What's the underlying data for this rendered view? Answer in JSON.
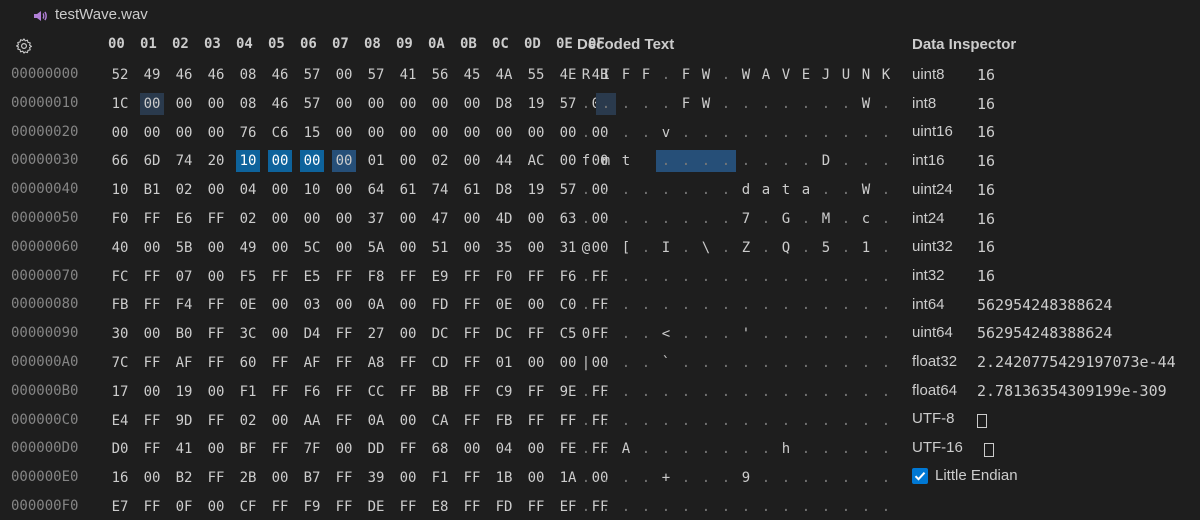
{
  "tab": {
    "filename": "testWave.wav",
    "icon": "speaker-icon"
  },
  "header": {
    "columns": [
      "00",
      "01",
      "02",
      "03",
      "04",
      "05",
      "06",
      "07",
      "08",
      "09",
      "0A",
      "0B",
      "0C",
      "0D",
      "0E",
      "0F"
    ],
    "decoded_title": "Decoded Text",
    "inspector_title": "Data Inspector"
  },
  "rows": [
    {
      "addr": "00000000",
      "hex": [
        "52",
        "49",
        "46",
        "46",
        "08",
        "46",
        "57",
        "00",
        "57",
        "41",
        "56",
        "45",
        "4A",
        "55",
        "4E",
        "4B"
      ],
      "text": [
        "R",
        "I",
        "F",
        "F",
        ".",
        "F",
        "W",
        ".",
        "W",
        "A",
        "V",
        "E",
        "J",
        "U",
        "N",
        "K"
      ]
    },
    {
      "addr": "00000010",
      "hex": [
        "1C",
        "00",
        "00",
        "00",
        "08",
        "46",
        "57",
        "00",
        "00",
        "00",
        "00",
        "00",
        "D8",
        "19",
        "57",
        "00"
      ],
      "text": [
        ".",
        ".",
        ".",
        ".",
        ".",
        "F",
        "W",
        ".",
        ".",
        ".",
        ".",
        ".",
        ".",
        ".",
        "W",
        "."
      ]
    },
    {
      "addr": "00000020",
      "hex": [
        "00",
        "00",
        "00",
        "00",
        "76",
        "C6",
        "15",
        "00",
        "00",
        "00",
        "00",
        "00",
        "00",
        "00",
        "00",
        "00"
      ],
      "text": [
        ".",
        ".",
        ".",
        ".",
        "v",
        ".",
        ".",
        ".",
        ".",
        ".",
        ".",
        ".",
        ".",
        ".",
        ".",
        "."
      ]
    },
    {
      "addr": "00000030",
      "hex": [
        "66",
        "6D",
        "74",
        "20",
        "10",
        "00",
        "00",
        "00",
        "01",
        "00",
        "02",
        "00",
        "44",
        "AC",
        "00",
        "00"
      ],
      "text": [
        "f",
        "m",
        "t",
        " ",
        ".",
        ".",
        ".",
        ".",
        ".",
        ".",
        ".",
        ".",
        "D",
        ".",
        ".",
        "."
      ]
    },
    {
      "addr": "00000040",
      "hex": [
        "10",
        "B1",
        "02",
        "00",
        "04",
        "00",
        "10",
        "00",
        "64",
        "61",
        "74",
        "61",
        "D8",
        "19",
        "57",
        "00"
      ],
      "text": [
        ".",
        ".",
        ".",
        ".",
        ".",
        ".",
        ".",
        ".",
        "d",
        "a",
        "t",
        "a",
        ".",
        ".",
        "W",
        "."
      ]
    },
    {
      "addr": "00000050",
      "hex": [
        "F0",
        "FF",
        "E6",
        "FF",
        "02",
        "00",
        "00",
        "00",
        "37",
        "00",
        "47",
        "00",
        "4D",
        "00",
        "63",
        "00"
      ],
      "text": [
        ".",
        ".",
        ".",
        ".",
        ".",
        ".",
        ".",
        ".",
        "7",
        ".",
        "G",
        ".",
        "M",
        ".",
        "c",
        "."
      ]
    },
    {
      "addr": "00000060",
      "hex": [
        "40",
        "00",
        "5B",
        "00",
        "49",
        "00",
        "5C",
        "00",
        "5A",
        "00",
        "51",
        "00",
        "35",
        "00",
        "31",
        "00"
      ],
      "text": [
        "@",
        ".",
        "[",
        ".",
        "I",
        ".",
        "\\",
        ".",
        "Z",
        ".",
        "Q",
        ".",
        "5",
        ".",
        "1",
        "."
      ]
    },
    {
      "addr": "00000070",
      "hex": [
        "FC",
        "FF",
        "07",
        "00",
        "F5",
        "FF",
        "E5",
        "FF",
        "F8",
        "FF",
        "E9",
        "FF",
        "F0",
        "FF",
        "F6",
        "FF"
      ],
      "text": [
        ".",
        ".",
        ".",
        ".",
        ".",
        ".",
        ".",
        ".",
        ".",
        ".",
        ".",
        ".",
        ".",
        ".",
        ".",
        "."
      ]
    },
    {
      "addr": "00000080",
      "hex": [
        "FB",
        "FF",
        "F4",
        "FF",
        "0E",
        "00",
        "03",
        "00",
        "0A",
        "00",
        "FD",
        "FF",
        "0E",
        "00",
        "C0",
        "FF"
      ],
      "text": [
        ".",
        ".",
        ".",
        ".",
        ".",
        ".",
        ".",
        ".",
        ".",
        ".",
        ".",
        ".",
        ".",
        ".",
        ".",
        "."
      ]
    },
    {
      "addr": "00000090",
      "hex": [
        "30",
        "00",
        "B0",
        "FF",
        "3C",
        "00",
        "D4",
        "FF",
        "27",
        "00",
        "DC",
        "FF",
        "DC",
        "FF",
        "C5",
        "FF"
      ],
      "text": [
        "0",
        ".",
        ".",
        ".",
        "<",
        ".",
        ".",
        ".",
        "'",
        ".",
        ".",
        ".",
        ".",
        ".",
        ".",
        "."
      ]
    },
    {
      "addr": "000000A0",
      "hex": [
        "7C",
        "FF",
        "AF",
        "FF",
        "60",
        "FF",
        "AF",
        "FF",
        "A8",
        "FF",
        "CD",
        "FF",
        "01",
        "00",
        "00",
        "00"
      ],
      "text": [
        "|",
        ".",
        ".",
        ".",
        "`",
        ".",
        ".",
        ".",
        ".",
        ".",
        ".",
        ".",
        ".",
        ".",
        ".",
        "."
      ]
    },
    {
      "addr": "000000B0",
      "hex": [
        "17",
        "00",
        "19",
        "00",
        "F1",
        "FF",
        "F6",
        "FF",
        "CC",
        "FF",
        "BB",
        "FF",
        "C9",
        "FF",
        "9E",
        "FF"
      ],
      "text": [
        ".",
        ".",
        ".",
        ".",
        ".",
        ".",
        ".",
        ".",
        ".",
        ".",
        ".",
        ".",
        ".",
        ".",
        ".",
        "."
      ]
    },
    {
      "addr": "000000C0",
      "hex": [
        "E4",
        "FF",
        "9D",
        "FF",
        "02",
        "00",
        "AA",
        "FF",
        "0A",
        "00",
        "CA",
        "FF",
        "FB",
        "FF",
        "FF",
        "FF"
      ],
      "text": [
        ".",
        ".",
        ".",
        ".",
        ".",
        ".",
        ".",
        ".",
        ".",
        ".",
        ".",
        ".",
        ".",
        ".",
        ".",
        "."
      ]
    },
    {
      "addr": "000000D0",
      "hex": [
        "D0",
        "FF",
        "41",
        "00",
        "BF",
        "FF",
        "7F",
        "00",
        "DD",
        "FF",
        "68",
        "00",
        "04",
        "00",
        "FE",
        "FF"
      ],
      "text": [
        ".",
        ".",
        "A",
        ".",
        ".",
        ".",
        ".",
        ".",
        ".",
        ".",
        "h",
        ".",
        ".",
        ".",
        ".",
        "."
      ]
    },
    {
      "addr": "000000E0",
      "hex": [
        "16",
        "00",
        "B2",
        "FF",
        "2B",
        "00",
        "B7",
        "FF",
        "39",
        "00",
        "F1",
        "FF",
        "1B",
        "00",
        "1A",
        "00"
      ],
      "text": [
        ".",
        ".",
        ".",
        ".",
        "+",
        ".",
        ".",
        ".",
        "9",
        ".",
        ".",
        ".",
        ".",
        ".",
        ".",
        "."
      ]
    },
    {
      "addr": "000000F0",
      "hex": [
        "E7",
        "FF",
        "0F",
        "00",
        "CF",
        "FF",
        "F9",
        "FF",
        "DE",
        "FF",
        "E8",
        "FF",
        "FD",
        "FF",
        "EF",
        "FF"
      ],
      "text": [
        ".",
        ".",
        ".",
        ".",
        ".",
        ".",
        ".",
        ".",
        ".",
        ".",
        ".",
        ".",
        ".",
        ".",
        ".",
        "."
      ]
    }
  ],
  "inspector": [
    {
      "label": "uint8",
      "value": "16"
    },
    {
      "label": "int8",
      "value": "16"
    },
    {
      "label": "uint16",
      "value": "16"
    },
    {
      "label": "int16",
      "value": "16"
    },
    {
      "label": "uint24",
      "value": "16"
    },
    {
      "label": "int24",
      "value": "16"
    },
    {
      "label": "uint32",
      "value": "16"
    },
    {
      "label": "int32",
      "value": "16"
    },
    {
      "label": "int64",
      "value": "562954248388624"
    },
    {
      "label": "uint64",
      "value": "562954248388624"
    },
    {
      "label": "float32",
      "value": "2.2420775429197073e-44"
    },
    {
      "label": "float64",
      "value": "2.78136354309199e-309"
    },
    {
      "label": "UTF-8",
      "value": ""
    },
    {
      "label": "UTF-16",
      "value": ""
    }
  ],
  "little_endian": {
    "label": "Little Endian",
    "checked": true
  },
  "colors": {
    "selection": "#0e639c",
    "hover": "#264f78",
    "background": "#1e1e1e"
  }
}
